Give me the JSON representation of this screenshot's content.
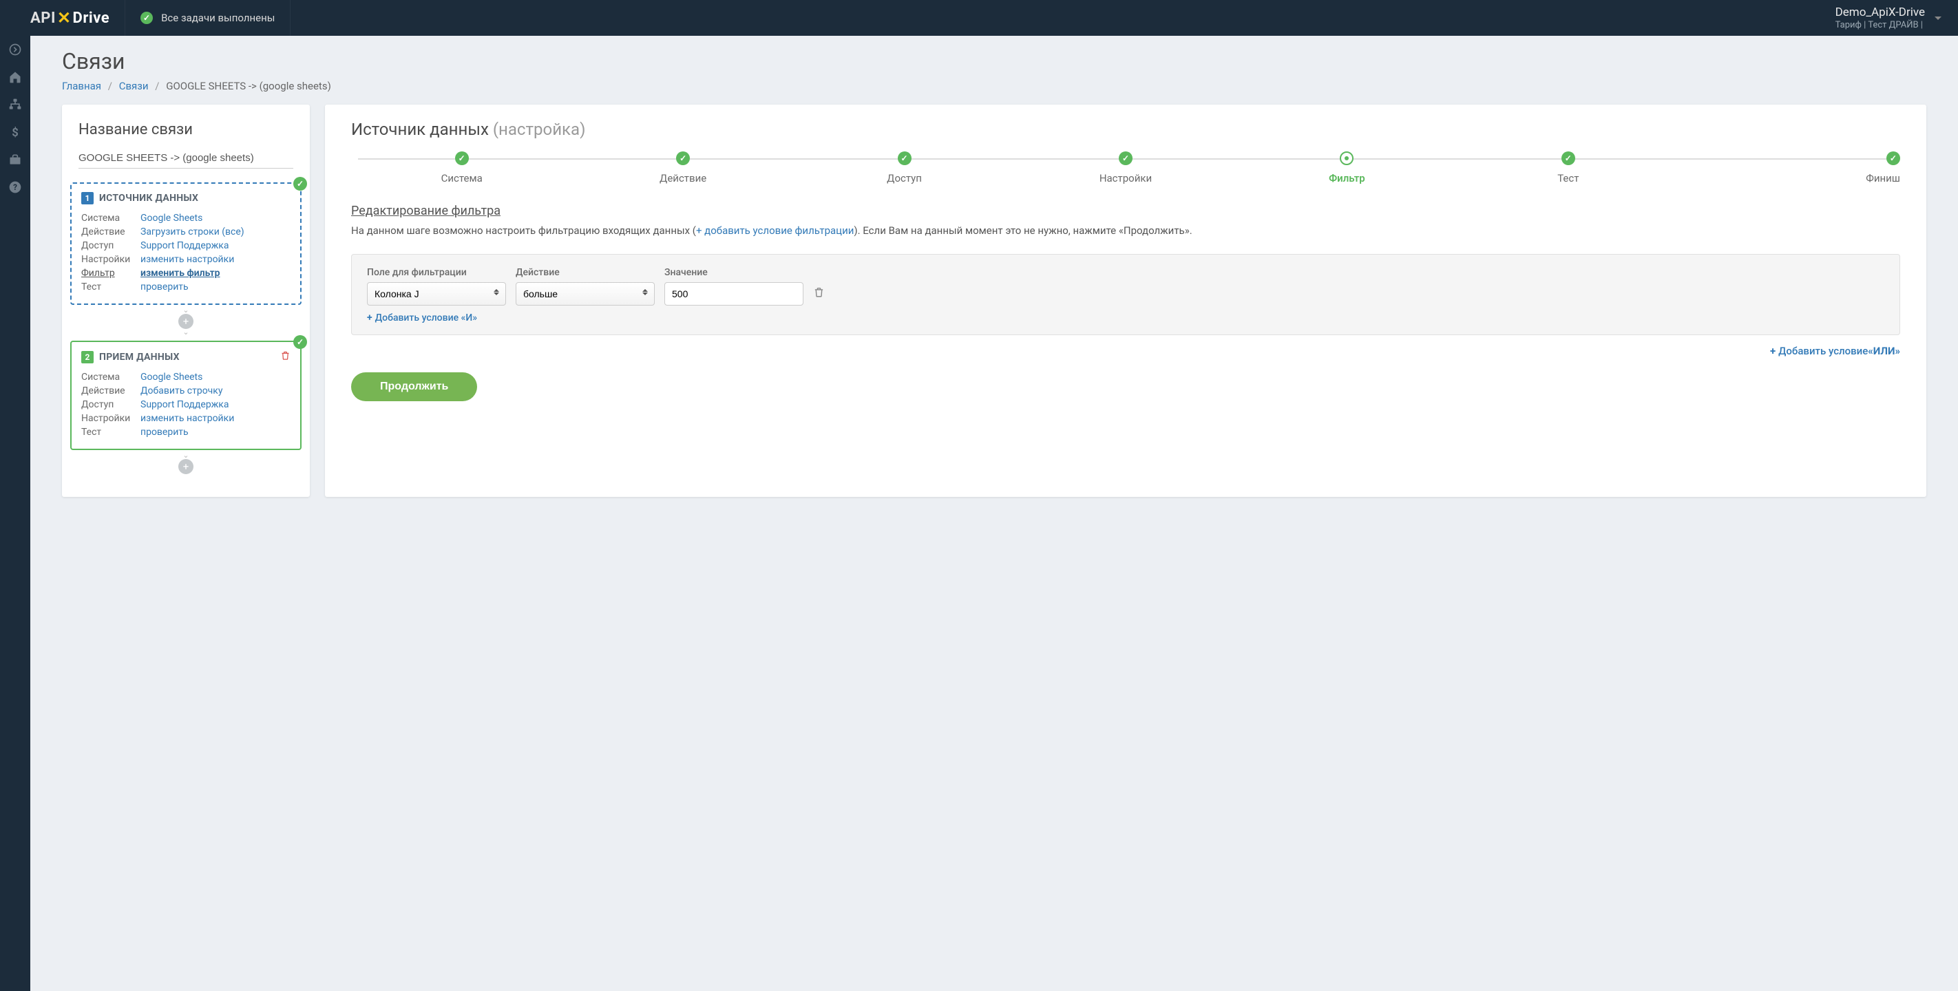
{
  "header": {
    "status": "Все задачи выполнены",
    "user_name": "Demo_ApiX-Drive",
    "tariff": "Тариф | Тест ДРАЙВ |"
  },
  "page": {
    "title": "Связи",
    "breadcrumb": {
      "home": "Главная",
      "links": "Связи",
      "current": "GOOGLE SHEETS -> (google sheets)"
    }
  },
  "left": {
    "section_title": "Название связи",
    "connection_name": "GOOGLE SHEETS -> (google sheets)",
    "source": {
      "title": "ИСТОЧНИК ДАННЫХ",
      "rows": {
        "system_l": "Система",
        "system_v": "Google Sheets",
        "action_l": "Действие",
        "action_v": "Загрузить строки (все)",
        "access_l": "Доступ",
        "access_v": "Support Поддержка",
        "settings_l": "Настройки",
        "settings_v": "изменить настройки",
        "filter_l": "Фильтр",
        "filter_v": "изменить фильтр",
        "test_l": "Тест",
        "test_v": "проверить"
      }
    },
    "dest": {
      "title": "ПРИЕМ ДАННЫХ",
      "rows": {
        "system_l": "Система",
        "system_v": "Google Sheets",
        "action_l": "Действие",
        "action_v": "Добавить строчку",
        "access_l": "Доступ",
        "access_v": "Support Поддержка",
        "settings_l": "Настройки",
        "settings_v": "изменить настройки",
        "test_l": "Тест",
        "test_v": "проверить"
      }
    }
  },
  "right": {
    "title": "Источник данных",
    "title_sub": "(настройка)",
    "steps": [
      "Система",
      "Действие",
      "Доступ",
      "Настройки",
      "Фильтр",
      "Тест",
      "Финиш"
    ],
    "sub_heading": "Редактирование фильтра",
    "desc_p1": "На данном шаге возможно настроить фильтрацию входящих данных (",
    "desc_link": "+ добавить условие фильтрации",
    "desc_p2": "). Если Вам на данный момент это не нужно, нажмите «Продолжить».",
    "filter": {
      "field_label": "Поле для фильтрации",
      "action_label": "Действие",
      "value_label": "Значение",
      "field_value": "Колонка J",
      "action_value": "больше",
      "value_value": "500",
      "add_and": "Добавить условие «И»",
      "add_or_prefix": "Добавить условие ",
      "add_or_bold": "«ИЛИ»"
    },
    "continue": "Продолжить"
  }
}
